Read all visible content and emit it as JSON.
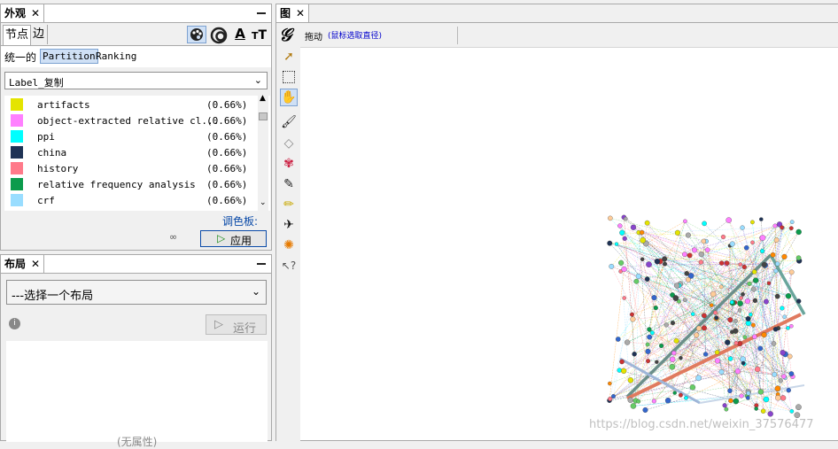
{
  "appearance": {
    "tab_title": "外观",
    "close": "✕",
    "subtabs": [
      "节点",
      "边"
    ],
    "modes": [
      "统一的",
      "Partition",
      "Ranking"
    ],
    "attribute": "Label_复制",
    "items": [
      {
        "label": "artifacts",
        "percent": "(0.66%)",
        "color": "#e4e400"
      },
      {
        "label": "object-extracted relative cl...",
        "percent": "(0.66%)",
        "color": "#ff80ff"
      },
      {
        "label": "ppi",
        "percent": "(0.66%)",
        "color": "#00ffff"
      },
      {
        "label": "china",
        "percent": "(0.66%)",
        "color": "#1f3355"
      },
      {
        "label": "history",
        "percent": "(0.66%)",
        "color": "#ff7a8a"
      },
      {
        "label": "relative frequency analysis",
        "percent": "(0.66%)",
        "color": "#0c9b4c"
      },
      {
        "label": "crf",
        "percent": "(0.66%)",
        "color": "#99ddff"
      }
    ],
    "palette_link": "调色板:",
    "apply": "应用",
    "text_icon_label": "A"
  },
  "layout": {
    "tab_title": "布局",
    "close": "✕",
    "select_placeholder": "---选择一个布局",
    "run": "运行",
    "no_properties": "(无属性)"
  },
  "graph": {
    "tab_title": "图",
    "close": "✕",
    "drag_label": "拖动",
    "hint": "(鼠标选取直径)",
    "watermark": "https://blog.csdn.net/weixin_37576477"
  },
  "colors": {
    "accent": "#0a4aa8",
    "link": "#0000cc",
    "selected_mode": "#cfe0f5"
  }
}
